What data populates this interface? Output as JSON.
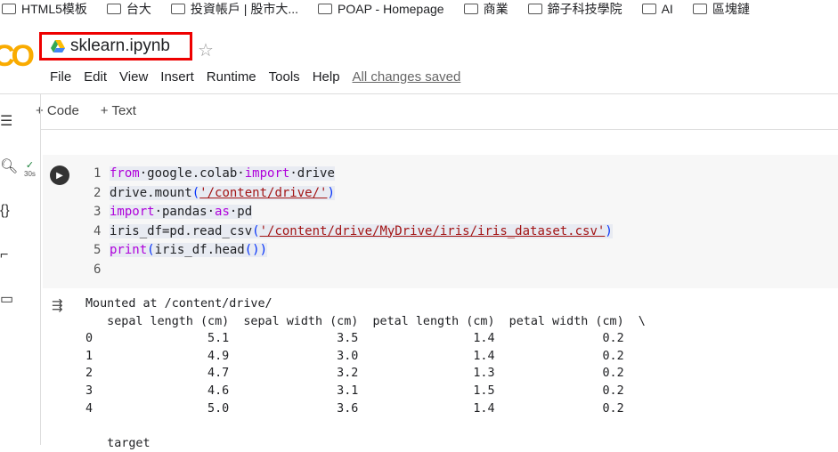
{
  "bookmarks": [
    "HTML5模板",
    "台大",
    "投資帳戶 | 股市大...",
    "POAP - Homepage",
    "商業",
    "鍗子科技學院",
    "AI",
    "區塊鏈"
  ],
  "notebook": {
    "title": "sklearn.ipynb",
    "logo": "CO"
  },
  "menu": [
    "File",
    "Edit",
    "View",
    "Insert",
    "Runtime",
    "Tools",
    "Help"
  ],
  "save_status": "All changes saved",
  "toolbar": {
    "code": "+ Code",
    "text": "+ Text"
  },
  "cell": {
    "status": "30s",
    "lines": [
      {
        "n": "1",
        "parts": [
          [
            "kw",
            "from"
          ],
          [
            "",
            "·google.colab·"
          ],
          [
            "kw",
            "import"
          ],
          [
            "",
            "·drive"
          ]
        ]
      },
      {
        "n": "2",
        "parts": [
          [
            "",
            "drive.mount"
          ],
          [
            "pa",
            "("
          ],
          [
            "st",
            "'/content/drive/'"
          ],
          [
            "pa",
            ")"
          ]
        ]
      },
      {
        "n": "3",
        "parts": [
          [
            "kw",
            "import"
          ],
          [
            "",
            "·pandas·"
          ],
          [
            "kw",
            "as"
          ],
          [
            "",
            "·pd"
          ]
        ]
      },
      {
        "n": "4",
        "parts": [
          [
            "",
            "iris_df=pd.read_csv"
          ],
          [
            "pa",
            "("
          ],
          [
            "st",
            "'/content/drive/MyDrive/iris/iris_dataset.csv'"
          ],
          [
            "pa",
            ")"
          ]
        ]
      },
      {
        "n": "5",
        "parts": [
          [
            "kw",
            "print"
          ],
          [
            "pa",
            "("
          ],
          [
            "",
            "iris_df.head"
          ],
          [
            "pa",
            "())"
          ]
        ]
      },
      {
        "n": "6",
        "parts": []
      }
    ]
  },
  "output": [
    "Mounted at /content/drive/",
    "   sepal length (cm)  sepal width (cm)  petal length (cm)  petal width (cm)  \\",
    "0                5.1               3.5                1.4               0.2",
    "1                4.9               3.0                1.4               0.2",
    "2                4.7               3.2                1.3               0.2",
    "3                4.6               3.1                1.5               0.2",
    "4                5.0               3.6                1.4               0.2",
    "",
    "   target"
  ]
}
